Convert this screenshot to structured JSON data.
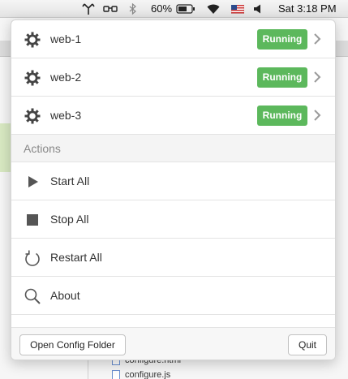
{
  "menubar": {
    "battery_percent": "60%",
    "clock": "Sat 3:18 PM",
    "icons": [
      "antenna-icon",
      "glasses-icon",
      "bluetooth-icon",
      "battery-icon",
      "wifi-icon",
      "us-flag-icon",
      "volume-icon"
    ]
  },
  "background_window": {
    "files": [
      "configure.html",
      "configure.js"
    ]
  },
  "menu": {
    "servers": [
      {
        "name": "web-1",
        "status": "Running"
      },
      {
        "name": "web-2",
        "status": "Running"
      },
      {
        "name": "web-3",
        "status": "Running"
      }
    ],
    "actions_header": "Actions",
    "actions": [
      {
        "label": "Start All",
        "icon": "play-icon"
      },
      {
        "label": "Stop All",
        "icon": "stop-icon"
      },
      {
        "label": "Restart All",
        "icon": "restart-icon"
      },
      {
        "label": "About",
        "icon": "magnifier-icon"
      }
    ],
    "footer": {
      "open_config_label": "Open Config Folder",
      "quit_label": "Quit"
    }
  },
  "colors": {
    "running_badge": "#5cb85c",
    "menu_background": "#ffffff"
  }
}
